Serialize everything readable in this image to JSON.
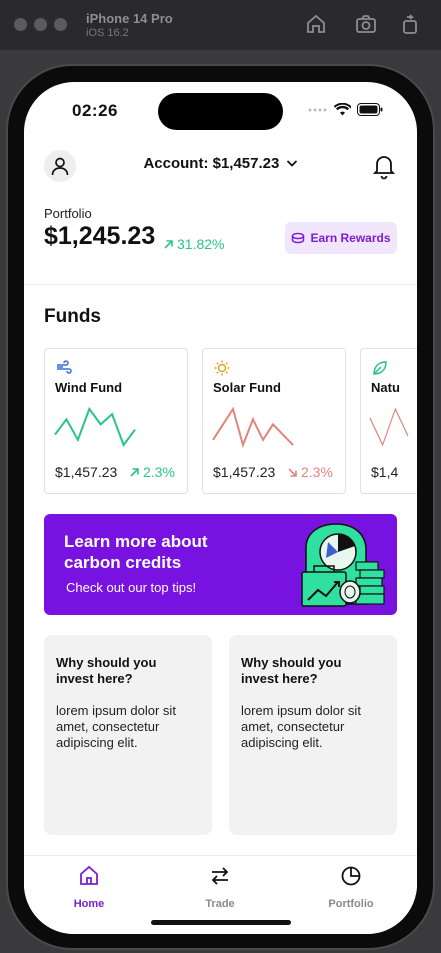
{
  "simulator": {
    "title": "iPhone 14 Pro",
    "subtitle": "iOS 16.2",
    "buttons": [
      "home-icon",
      "screenshot-icon",
      "rotate-icon"
    ]
  },
  "status": {
    "time": "02:26"
  },
  "header": {
    "account": "Account: $1,457.23"
  },
  "portfolio": {
    "label": "Portfolio",
    "value": "$1,245.23",
    "change": "31.82%",
    "earn_label": "Earn Rewards"
  },
  "funds": {
    "title": "Funds",
    "items": [
      {
        "icon": "wind-icon",
        "name": "Wind Fund",
        "value": "$1,457.23",
        "change": "2.3%",
        "direction": "up",
        "color": "#29c48a",
        "trend": [
          3,
          6,
          2,
          8,
          5,
          7,
          1,
          4
        ]
      },
      {
        "icon": "sun-icon",
        "name": "Solar Fund",
        "value": "$1,457.23",
        "change": "2.3%",
        "direction": "down",
        "color": "#e0857c",
        "trend": [
          2,
          5,
          8,
          1,
          6,
          2,
          5,
          3,
          1
        ]
      },
      {
        "icon": "leaf-icon",
        "name": "Natu",
        "value": "$1,4",
        "change": "",
        "direction": "down",
        "color": "#e0857c",
        "trend": [
          5,
          2,
          6,
          3
        ]
      }
    ]
  },
  "promo": {
    "title": "Learn more about carbon credits",
    "subtitle": "Check out our top tips!"
  },
  "info_cards": [
    {
      "question": "Why should you invest here?",
      "body": "lorem ipsum dolor sit amet, consectetur adipiscing elit."
    },
    {
      "question": "Why should you invest here?",
      "body": "lorem ipsum dolor sit amet, consectetur adipiscing elit."
    }
  ],
  "tabs": [
    {
      "label": "Home",
      "icon": "home-icon",
      "active": true
    },
    {
      "label": "Trade",
      "icon": "swap-icon",
      "active": false
    },
    {
      "label": "Portfolio",
      "icon": "pie-chart-icon",
      "active": false
    }
  ],
  "colors": {
    "accent": "#7812e0",
    "up": "#29c48a",
    "down": "#e0857c",
    "rewards_bg": "#f1e6fb"
  }
}
